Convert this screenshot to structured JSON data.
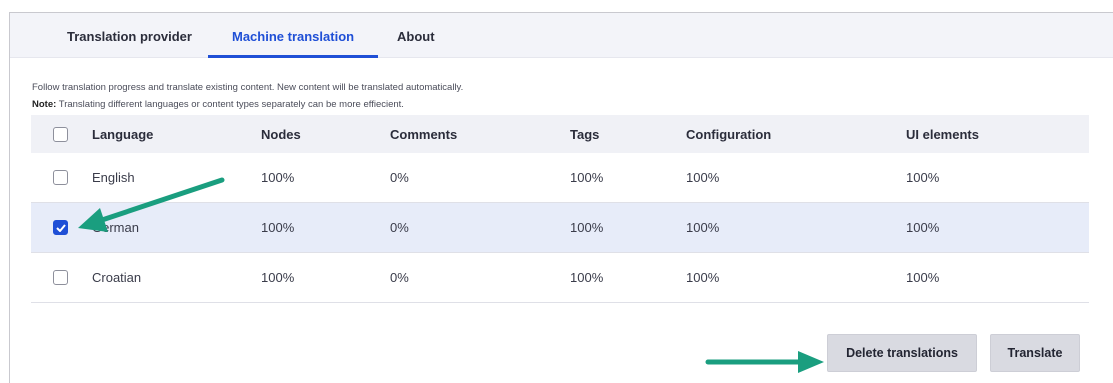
{
  "tabs": [
    {
      "label": "Translation provider",
      "active": false
    },
    {
      "label": "Machine translation",
      "active": true
    },
    {
      "label": "About",
      "active": false
    }
  ],
  "description": {
    "line1": "Follow translation progress and translate existing content. New content will be translated automatically.",
    "note_label": "Note:",
    "note_text": " Translating different languages or content types separately can be more effiecient."
  },
  "table": {
    "headers": [
      "Language",
      "Nodes",
      "Comments",
      "Tags",
      "Configuration",
      "UI elements"
    ],
    "rows": [
      {
        "language": "English",
        "nodes": "100%",
        "comments": "0%",
        "tags": "100%",
        "configuration": "100%",
        "ui_elements": "100%",
        "checked": false
      },
      {
        "language": "German",
        "nodes": "100%",
        "comments": "0%",
        "tags": "100%",
        "configuration": "100%",
        "ui_elements": "100%",
        "checked": true
      },
      {
        "language": "Croatian",
        "nodes": "100%",
        "comments": "0%",
        "tags": "100%",
        "configuration": "100%",
        "ui_elements": "100%",
        "checked": false
      }
    ]
  },
  "actions": {
    "delete_label": "Delete translations",
    "translate_label": "Translate"
  },
  "colors": {
    "accent": "#1f4fd6",
    "annotation_arrow": "#1a9e7f"
  }
}
